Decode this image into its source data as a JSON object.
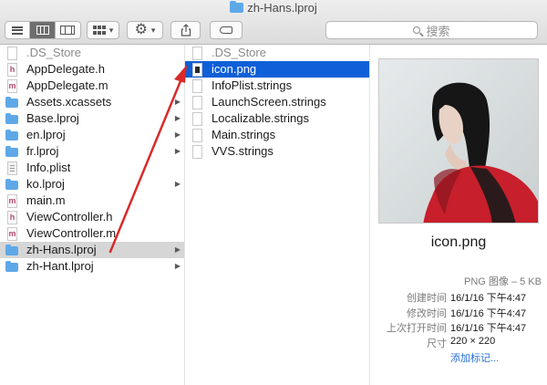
{
  "window": {
    "title": "zh-Hans.lproj"
  },
  "toolbar": {
    "search_placeholder": "搜索"
  },
  "column1": [
    {
      "label": ".DS_Store",
      "icon": "ds-store-icon",
      "dim": true
    },
    {
      "label": "AppDelegate.h",
      "icon": "header-file-icon",
      "letter": "h"
    },
    {
      "label": "AppDelegate.m",
      "icon": "source-file-icon",
      "letter": "m"
    },
    {
      "label": "Assets.xcassets",
      "icon": "folder-icon",
      "folder": true
    },
    {
      "label": "Base.lproj",
      "icon": "folder-icon",
      "folder": true
    },
    {
      "label": "en.lproj",
      "icon": "folder-icon",
      "folder": true
    },
    {
      "label": "fr.lproj",
      "icon": "folder-icon",
      "folder": true
    },
    {
      "label": "Info.plist",
      "icon": "plist-file-icon"
    },
    {
      "label": "ko.lproj",
      "icon": "folder-icon",
      "folder": true
    },
    {
      "label": "main.m",
      "icon": "source-file-icon",
      "letter": "m"
    },
    {
      "label": "ViewController.h",
      "icon": "header-file-icon",
      "letter": "h"
    },
    {
      "label": "ViewController.m",
      "icon": "source-file-icon",
      "letter": "m"
    },
    {
      "label": "zh-Hans.lproj",
      "icon": "folder-icon",
      "folder": true,
      "selected": true
    },
    {
      "label": "zh-Hant.lproj",
      "icon": "folder-icon",
      "folder": true
    }
  ],
  "column2": [
    {
      "label": ".DS_Store",
      "icon": "ds-store-icon",
      "dim": true
    },
    {
      "label": "icon.png",
      "icon": "image-file-icon",
      "selected": true
    },
    {
      "label": "InfoPlist.strings",
      "icon": "strings-file-icon"
    },
    {
      "label": "LaunchScreen.strings",
      "icon": "strings-file-icon"
    },
    {
      "label": "Localizable.strings",
      "icon": "strings-file-icon"
    },
    {
      "label": "Main.strings",
      "icon": "strings-file-icon"
    },
    {
      "label": "VVS.strings",
      "icon": "strings-file-icon"
    }
  ],
  "preview": {
    "filename": "icon.png",
    "kind": "PNG 图像 – 5 KB",
    "info": [
      {
        "key": "创建时间",
        "value": "16/1/16 下午4:47"
      },
      {
        "key": "修改时间",
        "value": "16/1/16 下午4:47"
      },
      {
        "key": "上次打开时间",
        "value": "16/1/16 下午4:47"
      },
      {
        "key": "尺寸",
        "value": "220 × 220"
      }
    ],
    "add_tags": "添加标记..."
  },
  "colors": {
    "selection": "#0e5fd8",
    "annotation_arrow": "#d92a2a",
    "link": "#2a6fd6"
  }
}
